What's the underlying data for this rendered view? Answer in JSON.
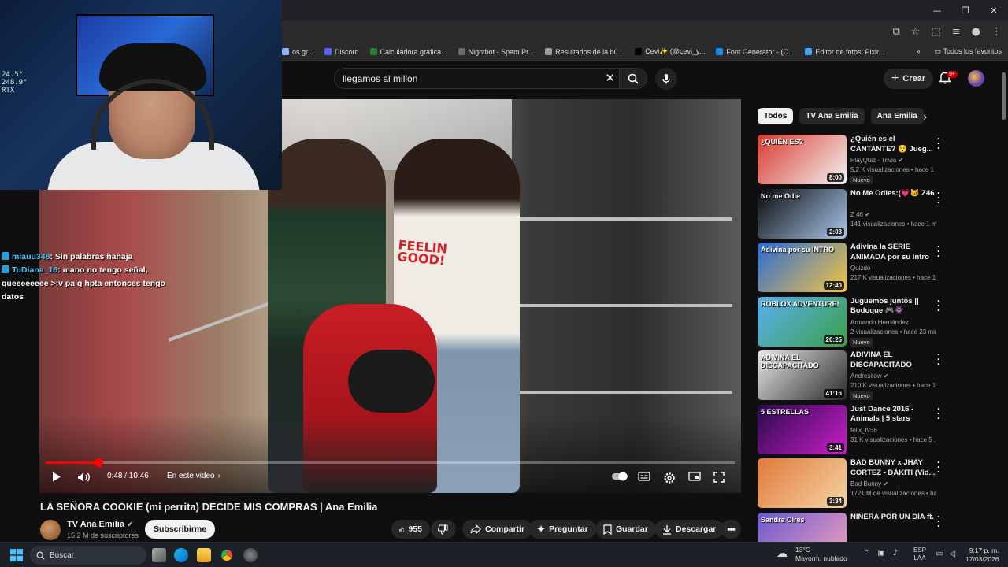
{
  "browser": {
    "window_controls": {
      "minimize": "—",
      "maximize": "❐",
      "close": "✕"
    },
    "bookmarks": [
      {
        "label": "os gr...",
        "color": "#8ab4f8"
      },
      {
        "label": "Discord",
        "color": "#5865f2"
      },
      {
        "label": "Calculadora gráfica...",
        "color": "#2e7d32"
      },
      {
        "label": "Nightbot - Spam Pr...",
        "color": "#6a6a6a"
      },
      {
        "label": "Resultados de la bú...",
        "color": "#9e9e9e"
      },
      {
        "label": "Cevi✨ (@cevi_y...",
        "color": "#000000"
      },
      {
        "label": "Font Generator - (C...",
        "color": "#1e88e5"
      },
      {
        "label": "Editor de fotos: Pixlr...",
        "color": "#42a5f5"
      }
    ],
    "bookmarks_more": "»",
    "all_favorites": "Todos los favoritos"
  },
  "header": {
    "search_value": "llegamos al millon",
    "create_label": "Crear",
    "notifications_badge": "9+"
  },
  "player": {
    "time": "0:48 / 10:46",
    "chapter": "En este video",
    "progress_fraction": 0.077
  },
  "webcam": {
    "hud": [
      "24.5°",
      "248.9°",
      "",
      "RTX"
    ]
  },
  "chat": [
    {
      "user": "miauu348",
      "message": ": Sin palabras hahaja"
    },
    {
      "user": "TuDiana_16",
      "message": ": mano no tengo señal, queeeeeeee >:v pa q hpta entonces tengo datos"
    }
  ],
  "video": {
    "title": "LA SEÑORA COOKIE (mi perrita) DECIDE MIS COMPRAS | Ana Emilia",
    "channel": "TV Ana Emilia",
    "subscribers": "15,2 M de suscriptores",
    "subscribe_label": "Subscribirme",
    "likes": "955",
    "share_label": "Compartir",
    "ask_label": "Preguntar",
    "save_label": "Guardar",
    "download_label": "Descargar",
    "shirt_text": "FEELIN\nGOOD!"
  },
  "sidebar": {
    "chips": [
      "Todos",
      "TV Ana Emilia",
      "Ana Emilia"
    ],
    "recommendations": [
      {
        "title": "¿Quién es el CANTANTE? 😯 Jueg...",
        "channel": "PlayQuiz - Trivia ✔",
        "meta": "5,2 K visualizaciones • hace 1 d...",
        "duration": "8:00",
        "badge": "Nuevo",
        "thumb_text": "¿QUIÉN ES?",
        "c1": "#d83a2e",
        "c2": "#f3f3f3"
      },
      {
        "title": "No Me Odies:(💗🐱 Z46",
        "channel": "Z 46 ✔",
        "meta": "141 visualizaciones • hace 1 m...",
        "duration": "2:03",
        "badge": "",
        "thumb_text": "No me Odie",
        "c1": "#0a0a0a",
        "c2": "#a9c7ec"
      },
      {
        "title": "Adivina la SERIE ANIMADA por su intro ...",
        "channel": "Quizdo",
        "meta": "217 K visualizaciones • hace 1 ...",
        "duration": "12:40",
        "badge": "",
        "thumb_text": "Adivina por su INTRO",
        "c1": "#2a6ad6",
        "c2": "#f4c542"
      },
      {
        "title": "Juguemos juntos || Bodoque 🎮👾",
        "channel": "Armando Hernández",
        "meta": "2 visualizaciones • hace 23 min...",
        "duration": "20:25",
        "badge": "Nuevo",
        "thumb_text": "ROBLOX ADVENTURE!",
        "c1": "#5ab0f0",
        "c2": "#3aa04a"
      },
      {
        "title": "ADIVINA EL DISCAPACITADO",
        "channel": "Andresitow ✔",
        "meta": "210 K visualizaciones • hace 1 ...",
        "duration": "41:16",
        "badge": "Nuevo",
        "thumb_text": "ADIVINA EL DISCAPACITADO",
        "c1": "#e8e8e8",
        "c2": "#2a2a2a"
      },
      {
        "title": "Just Dance 2016 - Animals | 5 stars",
        "channel": "felix_tv36",
        "meta": "31 K visualizaciones • hace 5 ...",
        "duration": "3:41",
        "badge": "",
        "thumb_text": "5 ESTRELLAS",
        "c1": "#2a0a4a",
        "c2": "#c81ec8"
      },
      {
        "title": "BAD BUNNY x JHAY CORTEZ - DÁKITI (Vid...",
        "channel": "Bad Bunny ✔",
        "meta": "1721 M de visualizaciones • ha...",
        "duration": "3:34",
        "badge": "",
        "thumb_text": "",
        "c1": "#e07a3a",
        "c2": "#f4d4a4"
      },
      {
        "title": "NIÑERA POR UN DÍA ft.",
        "channel": "",
        "meta": "",
        "duration": "",
        "badge": "",
        "thumb_text": "Sandra Cires",
        "c1": "#6a5acd",
        "c2": "#f0a0c0"
      }
    ]
  },
  "taskbar": {
    "search_label": "Buscar",
    "weather_temp": "13°C",
    "weather_desc": "Mayorm. nublado",
    "lang1": "ESP",
    "lang2": "LAA",
    "time": "9:17 p. m.",
    "date": "17/03/2026"
  }
}
